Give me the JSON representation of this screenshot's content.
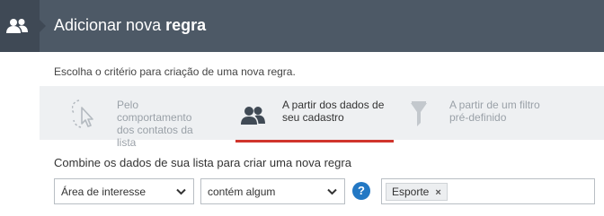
{
  "header": {
    "icon": "users-icon",
    "title_prefix": "Adicionar nova",
    "title_bold": "regra"
  },
  "subtitle": "Escolha o critério para criação de uma nova regra.",
  "tabs": [
    {
      "label": "Pelo comportamento\ndos contatos da lista",
      "icon": "cursor-click-icon",
      "active": false
    },
    {
      "label": "A partir dos dados de\nseu cadastro",
      "icon": "users-icon",
      "active": true
    },
    {
      "label": "A partir de um filtro\npré-definido",
      "icon": "filter-icon",
      "active": false
    }
  ],
  "combine_text": "Combine os dados de sua lista para criar uma nova regra",
  "field_select": {
    "value": "Área de interesse"
  },
  "operator_select": {
    "value": "contém algum"
  },
  "help": {
    "label": "?"
  },
  "tags": [
    {
      "label": "Esporte",
      "remove": "×"
    }
  ],
  "colors": {
    "header_bg": "#4d5966",
    "active_underline": "#d0342c",
    "help_bg": "#2378c4"
  }
}
